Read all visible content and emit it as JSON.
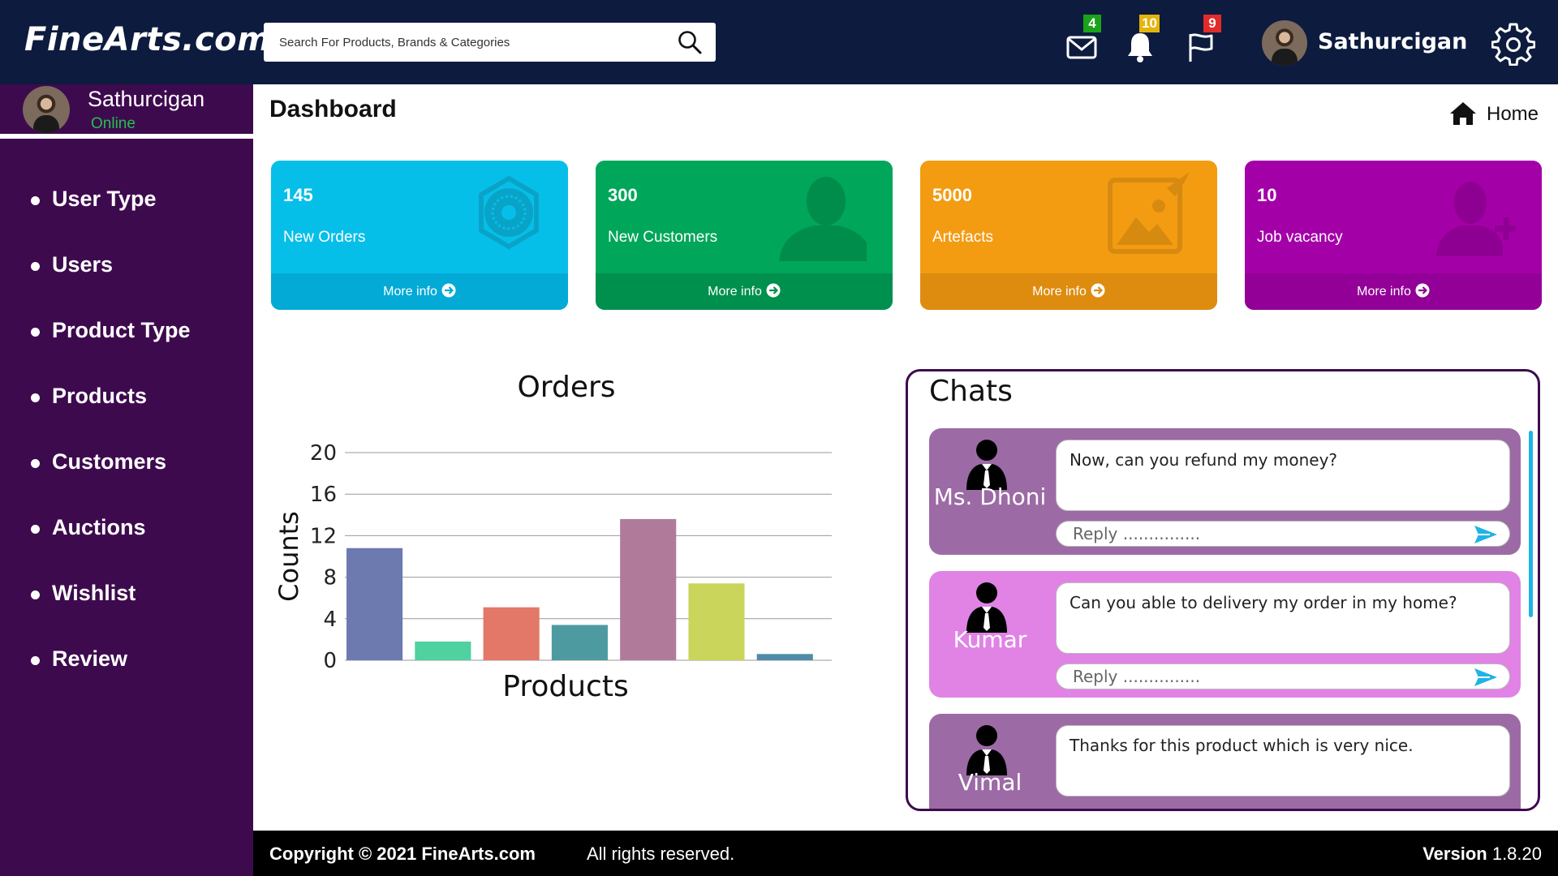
{
  "app": {
    "logo": "FineArts.com"
  },
  "search": {
    "placeholder": "Search For Products, Brands & Categories"
  },
  "topbar": {
    "mail_badge": "4",
    "bell_badge": "10",
    "flag_badge": "9",
    "user_name": "Sathurcigan",
    "colors": {
      "mail_badge": "#1aa31a",
      "bell_badge": "#e3b40c",
      "flag_badge": "#e22b2b"
    }
  },
  "sidebar": {
    "user_name": "Sathurcigan",
    "status": "Online",
    "items": [
      {
        "label": "User Type"
      },
      {
        "label": "Users"
      },
      {
        "label": "Product Type"
      },
      {
        "label": "Products"
      },
      {
        "label": "Customers"
      },
      {
        "label": "Auctions"
      },
      {
        "label": "Wishlist"
      },
      {
        "label": "Review"
      }
    ]
  },
  "page": {
    "title": "Dashboard",
    "home_label": "Home"
  },
  "cards": [
    {
      "value": "145",
      "label": "New Orders",
      "more": "More info",
      "icon": "starburst-badge-icon",
      "color": "#06bfe9",
      "foot_color": "#03aad6"
    },
    {
      "value": "300",
      "label": "New Customers",
      "more": "More info",
      "icon": "person-silhouette-icon",
      "color": "#00a65a",
      "foot_color": "#00904d"
    },
    {
      "value": "5000",
      "label": "Artefacts",
      "more": "More info",
      "icon": "image-edit-icon",
      "color": "#f39c12",
      "foot_color": "#de8c0f"
    },
    {
      "value": "10",
      "label": "Job vacancy",
      "more": "More info",
      "icon": "add-user-icon",
      "color": "#a400a8",
      "foot_color": "#930097"
    }
  ],
  "chart_title": "Orders",
  "chart_data": {
    "type": "bar",
    "title": "Orders",
    "xlabel": "Products",
    "ylabel": "Counts",
    "ylim": [
      0,
      20
    ],
    "yticks": [
      "0",
      "4",
      "8",
      "12",
      "16",
      "20"
    ],
    "grid": true,
    "values": [
      10.8,
      1.8,
      5.1,
      3.4,
      13.6,
      7.4,
      0.6
    ],
    "colors": [
      "#6d7ab0",
      "#4fd1a0",
      "#e37868",
      "#4d9ba0",
      "#b07b9a",
      "#cad55b",
      "#4f8ba8"
    ]
  },
  "chats": {
    "title": "Chats",
    "items": [
      {
        "name": "Ms. Dhoni",
        "message": "Now, can you refund my money?",
        "reply_placeholder": "Reply ...............",
        "color": "#9c6aa5"
      },
      {
        "name": "Kumar",
        "message": "Can you able to delivery my order in my home?",
        "reply_placeholder": "Reply ...............",
        "color": "#e083e5"
      },
      {
        "name": "Vimal",
        "message": "Thanks for this product which is very nice.",
        "reply_placeholder": "",
        "color": "#9c6aa5"
      }
    ]
  },
  "footer": {
    "copyright": "Copyright  ©  2021  FineArts.com",
    "rights": "All rights reserved.",
    "version_label": "Version",
    "version": "1.8.20"
  }
}
